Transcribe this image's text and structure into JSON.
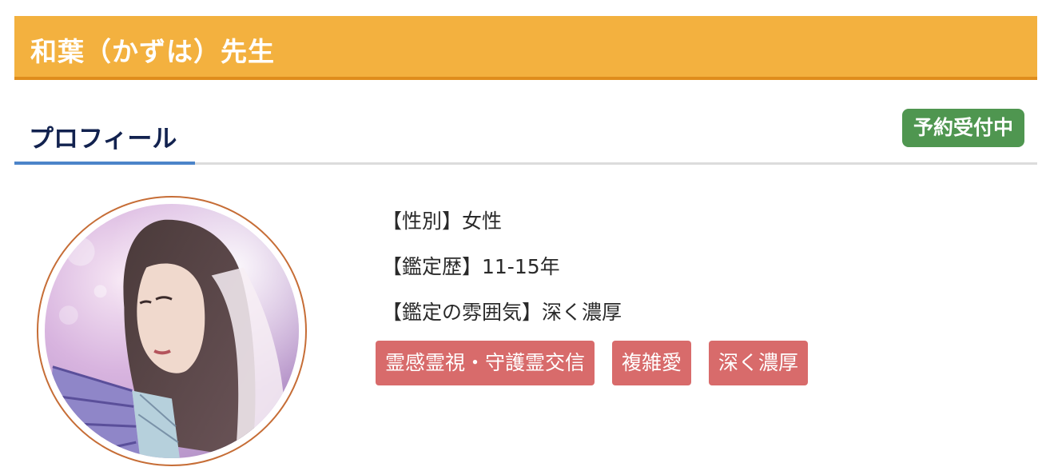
{
  "header": {
    "title": "和葉（かずは）先生"
  },
  "tabs": {
    "active_label": "プロフィール"
  },
  "status": {
    "label": "予約受付中",
    "color": "#4f9650"
  },
  "avatar": {
    "icon": "fortune-teller-portrait"
  },
  "profile": {
    "gender": "【性別】女性",
    "experience": "【鑑定歴】11-15年",
    "atmosphere": "【鑑定の雰囲気】深く濃厚"
  },
  "tags": [
    "霊感霊視・守護霊交信",
    "複雑愛",
    "深く濃厚"
  ],
  "colors": {
    "header_bg": "#f3b13f",
    "header_border": "#df8d1c",
    "tab_underline": "#4c84c9",
    "tag_bg": "#d86b6b",
    "avatar_border": "#c66d36"
  }
}
